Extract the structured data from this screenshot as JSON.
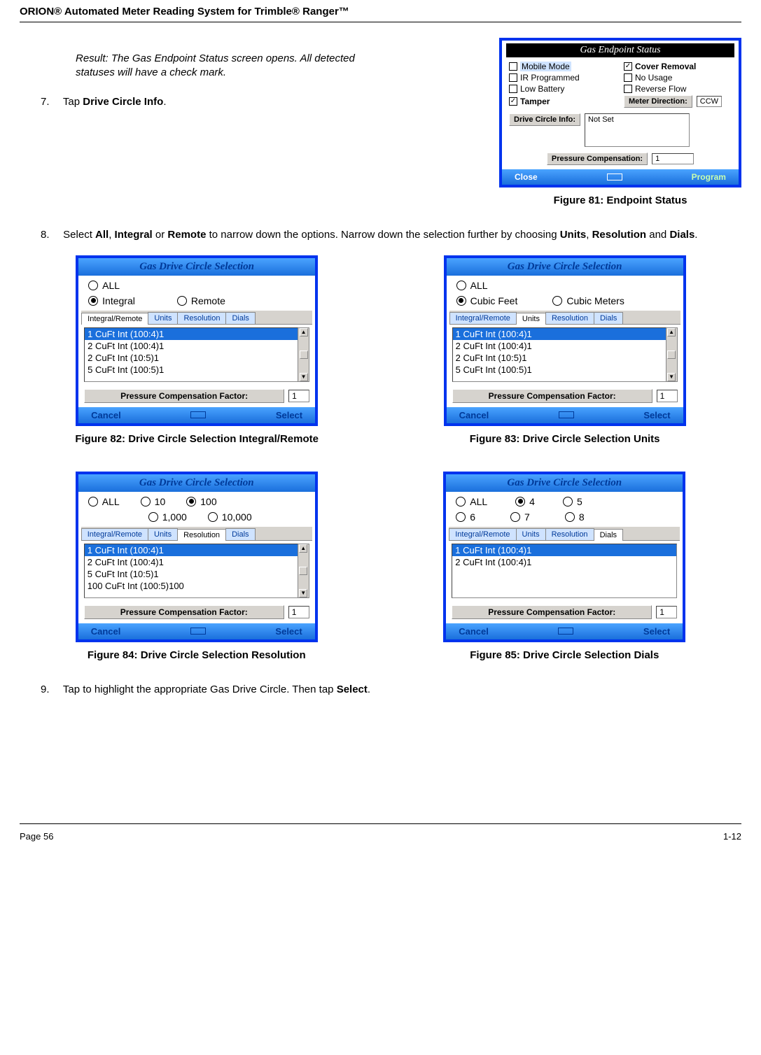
{
  "header": "ORION® Automated Meter Reading System for Trimble® Ranger™",
  "result_text": "Result: The Gas Endpoint Status screen opens. All detected statuses will have a check mark.",
  "step7": {
    "num": "7.",
    "pre": "Tap ",
    "bold": "Drive Circle Info",
    "post": "."
  },
  "step8": {
    "num": "8.",
    "t1": "Select ",
    "b1": "All",
    "t2": ", ",
    "b2": "Integral",
    "t3": " or ",
    "b3": "Remote",
    "t4": " to narrow down the options. Narrow down the selection further by choosing ",
    "b4": "Units",
    "t5": ", ",
    "b5": "Resolution",
    "t6": " and ",
    "b6": "Dials",
    "t7": "."
  },
  "step9": {
    "num": "9.",
    "t1": "Tap to highlight the appropriate Gas Drive Circle. Then tap ",
    "b1": "Select",
    "t2": "."
  },
  "fig81": {
    "caption": "Figure 81:  Endpoint Status",
    "title": "Gas Endpoint Status",
    "checks": {
      "mobile_mode": {
        "label": "Mobile Mode",
        "checked": false,
        "highlight": true
      },
      "cover_removal": {
        "label": "Cover Removal",
        "checked": true,
        "bold": true
      },
      "ir_programmed": {
        "label": "IR Programmed",
        "checked": false
      },
      "no_usage": {
        "label": "No Usage",
        "checked": false
      },
      "low_battery": {
        "label": "Low Battery",
        "checked": false
      },
      "reverse_flow": {
        "label": "Reverse Flow",
        "checked": false
      },
      "tamper": {
        "label": "Tamper",
        "checked": true,
        "bold": true
      }
    },
    "meter_dir_label": "Meter Direction:",
    "meter_dir_value": "CCW",
    "dci_label": "Drive Circle Info:",
    "dci_value": "Not Set",
    "pc_label": "Pressure Compensation:",
    "pc_value": "1",
    "close": "Close",
    "program": "Program"
  },
  "common_dcs": {
    "title": "Gas Drive Circle Selection",
    "tabs": [
      "Integral/Remote",
      "Units",
      "Resolution",
      "Dials"
    ],
    "pcf_label": "Pressure Compensation Factor:",
    "pcf_value": "1",
    "cancel": "Cancel",
    "select": "Select"
  },
  "fig82": {
    "caption": "Figure 82:  Drive Circle Selection Integral/Remote",
    "radios": [
      {
        "label": "ALL",
        "checked": false
      },
      {
        "label": "Integral",
        "checked": true
      },
      {
        "label": "Remote",
        "checked": false
      }
    ],
    "active_tab": 0,
    "list": [
      "1 CuFt Int (100:4)1",
      "2 CuFt Int (100:4)1",
      "2 CuFt Int (10:5)1",
      "5 CuFt Int (100:5)1"
    ]
  },
  "fig83": {
    "caption": "Figure 83:  Drive Circle Selection Units",
    "radios": [
      {
        "label": "ALL",
        "checked": false
      },
      {
        "label": "Cubic Feet",
        "checked": true
      },
      {
        "label": "Cubic Meters",
        "checked": false
      }
    ],
    "active_tab": 1,
    "list": [
      "1 CuFt Int (100:4)1",
      "2 CuFt Int (100:4)1",
      "2 CuFt Int (10:5)1",
      "5 CuFt Int (100:5)1"
    ]
  },
  "fig84": {
    "caption": "Figure 84:  Drive Circle Selection Resolution",
    "radios": [
      {
        "label": "ALL",
        "checked": false
      },
      {
        "label": "10",
        "checked": false
      },
      {
        "label": "100",
        "checked": true
      },
      {
        "label": "1,000",
        "checked": false
      },
      {
        "label": "10,000",
        "checked": false
      }
    ],
    "active_tab": 2,
    "list": [
      "1 CuFt Int (100:4)1",
      "2 CuFt Int (100:4)1",
      "5 CuFt Int (10:5)1",
      "100 CuFt Int (100:5)100"
    ]
  },
  "fig85": {
    "caption": "Figure 85:  Drive Circle Selection Dials",
    "radios": [
      {
        "label": "ALL",
        "checked": false
      },
      {
        "label": "4",
        "checked": true
      },
      {
        "label": "5",
        "checked": false
      },
      {
        "label": "6",
        "checked": false
      },
      {
        "label": "7",
        "checked": false
      },
      {
        "label": "8",
        "checked": false
      }
    ],
    "active_tab": 3,
    "list": [
      "1 CuFt Int (100:4)1",
      "2 CuFt Int (100:4)1"
    ]
  },
  "footer": {
    "left": "Page 56",
    "right": "1-12"
  }
}
